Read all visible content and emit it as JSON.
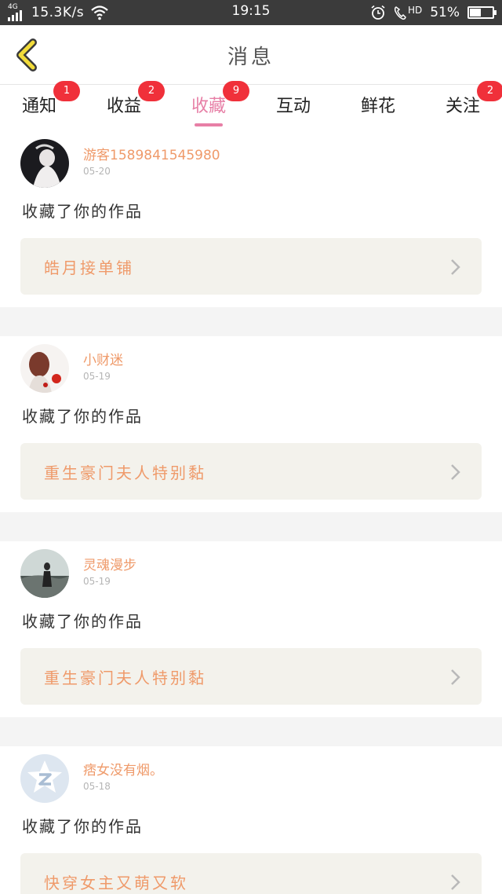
{
  "status_bar": {
    "network": "4G",
    "speed": "15.3K/s",
    "time": "19:15",
    "battery_percent": "51%",
    "battery_level": 0.51,
    "hd_label": "HD"
  },
  "header": {
    "title": "消息"
  },
  "tabs": [
    {
      "label": "通知",
      "badge": "1"
    },
    {
      "label": "收益",
      "badge": "2"
    },
    {
      "label": "收藏",
      "badge": "9",
      "active": true
    },
    {
      "label": "互动",
      "badge": ""
    },
    {
      "label": "鲜花",
      "badge": ""
    },
    {
      "label": "关注",
      "badge": "2"
    }
  ],
  "messages": [
    {
      "user": "游客15898415459​80",
      "date": "05-20",
      "text": "收藏了你的作品",
      "work": "皓月接单铺"
    },
    {
      "user": "小财迷",
      "date": "05-19",
      "text": "收藏了你的作品",
      "work": "重生豪门夫人特别黏"
    },
    {
      "user": "灵魂漫步",
      "date": "05-19",
      "text": "收藏了你的作品",
      "work": "重生豪门夫人特别黏"
    },
    {
      "user": "痞女没有烟。",
      "date": "05-18",
      "text": "收藏了你的作品",
      "work": "快穿女主又萌又软"
    }
  ],
  "colors": {
    "accent_pink": "#e77fa6",
    "username_orange": "#ef9a6a",
    "badge_red": "#f0303a",
    "back_arrow_yellow": "#f2dc3a",
    "status_bar": "#3b3b3b"
  }
}
